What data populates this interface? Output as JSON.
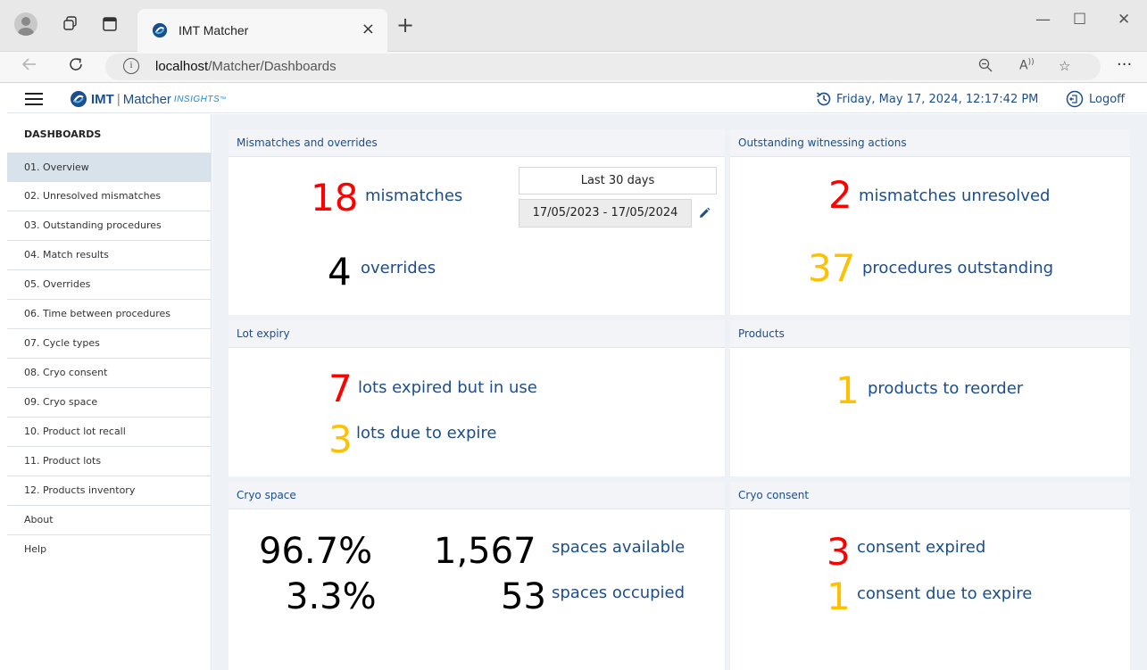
{
  "browser": {
    "tab_title": "IMT Matcher",
    "tab_close": "×",
    "new_tab": "+",
    "url_host": "localhost",
    "url_path": "/Matcher/Dashboards",
    "more": "···",
    "read_aloud": "A))",
    "minimize": "—",
    "maximize": "☐",
    "close": "✕"
  },
  "header": {
    "logo_imt": "IMT",
    "logo_sep": "|",
    "logo_matcher": "Matcher",
    "logo_insights": "INSIGHTS",
    "logo_tm": "™",
    "datetime": "Friday, May 17, 2024, 12:17:42 PM",
    "logoff": "Logoff"
  },
  "sidebar": {
    "heading": "DASHBOARDS",
    "items": [
      {
        "label": "01. Overview"
      },
      {
        "label": "02. Unresolved mismatches"
      },
      {
        "label": "03. Outstanding procedures"
      },
      {
        "label": "04. Match results"
      },
      {
        "label": "05. Overrides"
      },
      {
        "label": "06. Time between procedures"
      },
      {
        "label": "07. Cycle types"
      },
      {
        "label": "08. Cryo consent"
      },
      {
        "label": "09. Cryo space"
      },
      {
        "label": "10. Product lot recall"
      },
      {
        "label": "11. Product lots"
      },
      {
        "label": "12. Products inventory"
      },
      {
        "label": "About"
      },
      {
        "label": "Help"
      }
    ],
    "active_index": 0
  },
  "cards": {
    "mismatches": {
      "title": "Mismatches and overrides",
      "mismatch_count": "18",
      "mismatch_label": "mismatches",
      "override_count": "4",
      "override_label": "overrides",
      "range_label": "Last 30 days",
      "range_value": "17/05/2023 - 17/05/2024"
    },
    "witnessing": {
      "title": "Outstanding witnessing actions",
      "unresolved_count": "2",
      "unresolved_label": "mismatches unresolved",
      "outstanding_count": "37",
      "outstanding_label": "procedures outstanding"
    },
    "lot_expiry": {
      "title": "Lot expiry",
      "expired_count": "7",
      "expired_label": "lots expired but in use",
      "due_count": "3",
      "due_label": "lots due to expire"
    },
    "products": {
      "title": "Products",
      "reorder_count": "1",
      "reorder_label": "products to reorder"
    },
    "cryo_space": {
      "title": "Cryo space",
      "available_pct": "96.7%",
      "available_count": "1,567",
      "available_label": "spaces available",
      "occupied_pct": "3.3%",
      "occupied_count": "53",
      "occupied_label": "spaces occupied"
    },
    "cryo_consent": {
      "title": "Cryo consent",
      "expired_count": "3",
      "expired_label": "consent expired",
      "due_count": "1",
      "due_label": "consent due to expire"
    }
  },
  "colors": {
    "accent_blue": "#1b4e8c",
    "red": "#ff0000",
    "amber": "#ffc000",
    "active_item": "#d7e2eb"
  }
}
